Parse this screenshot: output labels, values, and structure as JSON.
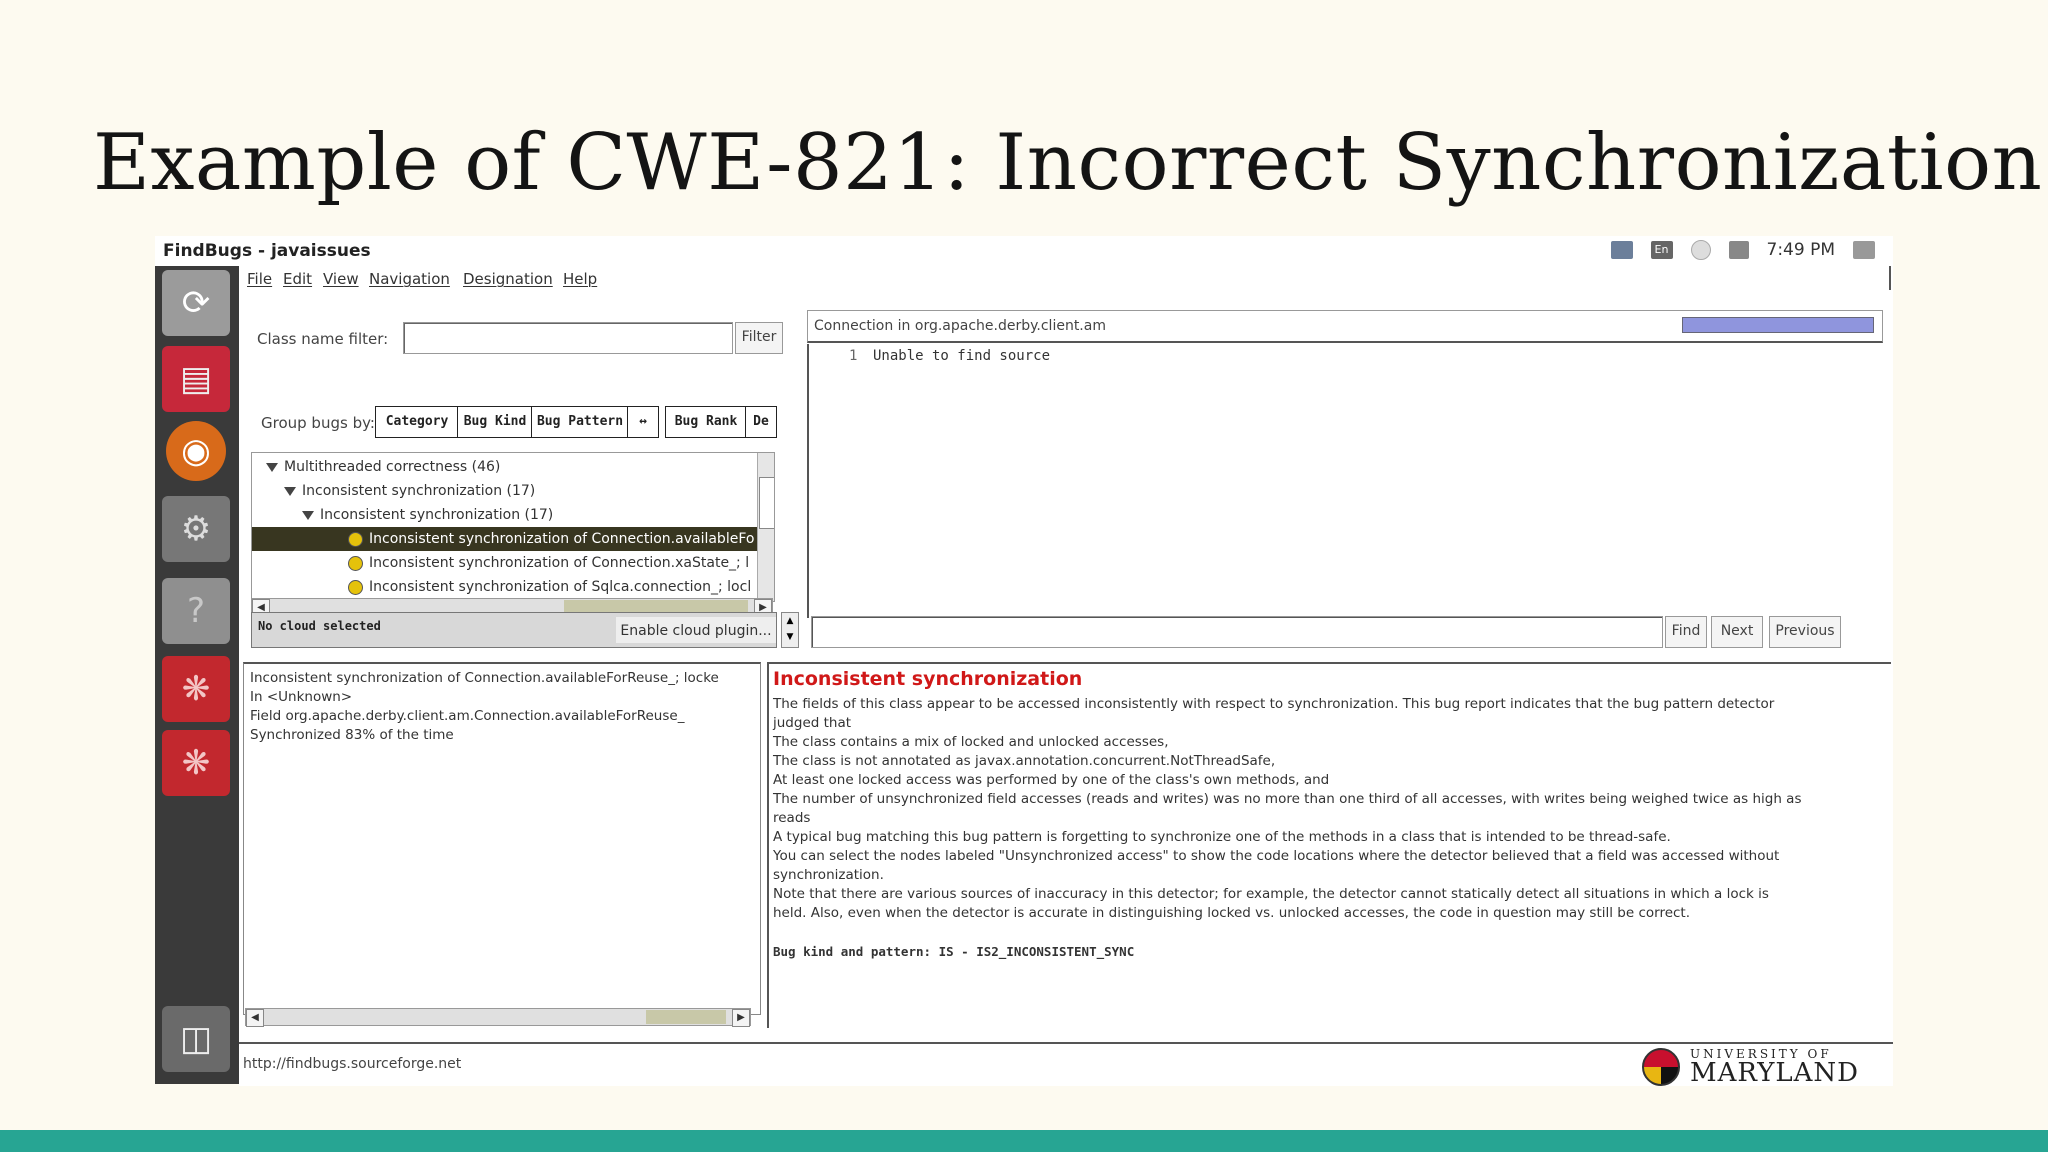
{
  "slide": {
    "title": "Example of CWE-821: Incorrect Synchronization"
  },
  "colors": {
    "slide_background": "#fdfaf0",
    "bottom_band": "#27a593",
    "bug_title": "#d01818",
    "selected_row": "#383620",
    "bug_dot": "#e5c20b"
  },
  "screenshot": {
    "window_title": "FindBugs - javaissues",
    "tray": {
      "icons": [
        "network-icon",
        "keyboard-layout-icon",
        "power-icon",
        "volume-icon",
        "settings-icon"
      ],
      "keyboard_label": "En",
      "clock": "7:49 PM"
    },
    "launcher": {
      "icons": [
        "ubuntu-home-icon",
        "files-icon",
        "firefox-icon",
        "system-settings-icon",
        "help-icon",
        "findbugs-icon",
        "findbugs-icon",
        "trash-icon"
      ]
    },
    "menubar": {
      "items": [
        "File",
        "Edit",
        "View",
        "Navigation",
        "Designation",
        "Help"
      ]
    },
    "filter": {
      "label": "Class name filter:",
      "value": "",
      "button": "Filter"
    },
    "group_by": {
      "label": "Group bugs by:",
      "tabs": [
        "Category",
        "Bug Kind",
        "Bug Pattern",
        "↔",
        "Bug Rank",
        "De"
      ]
    },
    "tree": {
      "rows": [
        {
          "text": "Multithreaded correctness (46)",
          "level": 0,
          "expanded": true
        },
        {
          "text": "Inconsistent synchronization (17)",
          "level": 1,
          "expanded": true
        },
        {
          "text": "Inconsistent synchronization (17)",
          "level": 2,
          "expanded": true
        },
        {
          "text": "Inconsistent synchronization of Connection.availableFo",
          "level": 3,
          "selected": true
        },
        {
          "text": "Inconsistent synchronization of Connection.xaState_; l",
          "level": 3
        },
        {
          "text": "Inconsistent synchronization of Sqlca.connection_; locl",
          "level": 3
        }
      ]
    },
    "cloud": {
      "status": "No cloud selected",
      "button": "Enable cloud plugin..."
    },
    "source": {
      "header": "Connection in org.apache.derby.client.am",
      "line_number": "1",
      "line_text": "Unable to find source"
    },
    "find": {
      "value": "",
      "buttons": [
        "Find",
        "Next",
        "Previous"
      ]
    },
    "details_left": {
      "lines": [
        "Inconsistent synchronization of Connection.availableForReuse_; locke",
        "In <Unknown>",
        "Field org.apache.derby.client.am.Connection.availableForReuse_",
        "Synchronized 83% of the time"
      ]
    },
    "details_right": {
      "title": "Inconsistent synchronization",
      "lines": [
        "The fields of this class appear to be accessed inconsistently with respect to synchronization.  This bug report indicates that the bug pattern detector",
        "judged that",
        "The class contains a mix of locked and unlocked accesses,",
        "The class is not annotated as javax.annotation.concurrent.NotThreadSafe,",
        "At least one locked access was performed by one of the class's own methods, and",
        "The number of unsynchronized field accesses (reads and writes) was no more than one third of all accesses, with writes being weighed twice as high as",
        "reads",
        "A typical bug matching this bug pattern is forgetting to synchronize one of the methods in a class that is intended to be thread-safe.",
        "You can select the nodes labeled \"Unsynchronized access\" to show the code locations where the detector believed that a field was accessed without",
        "synchronization.",
        "Note that there are various sources of inaccuracy in this detector; for example, the detector cannot statically detect all situations in which a lock is",
        "held.  Also, even when the detector is accurate in distinguishing locked vs. unlocked accesses, the code in question may still be correct."
      ],
      "pattern_line": "Bug kind and pattern: IS - IS2_INCONSISTENT_SYNC"
    },
    "status_url": "http://findbugs.sourceforge.net",
    "logo": {
      "top": "UNIVERSITY OF",
      "bottom": "MARYLAND"
    }
  }
}
